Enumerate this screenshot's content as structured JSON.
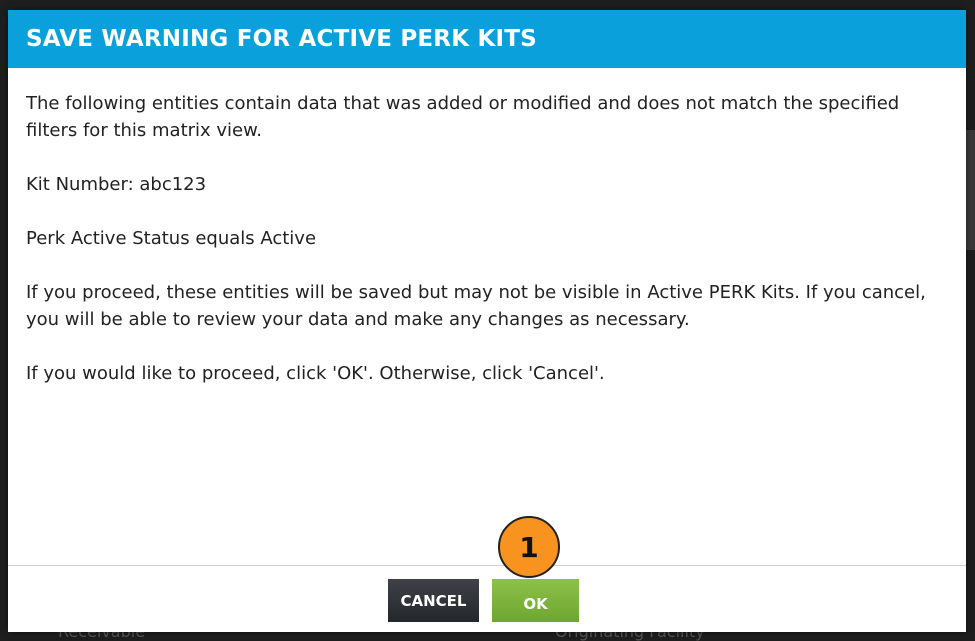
{
  "backdrop": {
    "bottom_left_text": "Receivable",
    "bottom_right_text": "Originating Facility"
  },
  "dialog": {
    "title": "SAVE WARNING FOR ACTIVE PERK KITS",
    "paragraphs": [
      "The following entities contain data that was added or modified and does not match the specified filters for this matrix view.",
      "Kit Number: abc123",
      "Perk Active Status equals Active",
      "If you proceed, these entities will be saved but may not be visible in Active PERK Kits. If you cancel, you will be able to review your data and make any changes as necessary.",
      "If you would like to proceed, click 'OK'. Otherwise, click 'Cancel'."
    ],
    "cancel_label": "CANCEL",
    "ok_label": "OK"
  },
  "annotation": {
    "step_number": "1"
  },
  "colors": {
    "header": "#0aa0dc",
    "ok_button": "#7cb83a",
    "cancel_button": "#30333a",
    "badge": "#f7931e"
  }
}
